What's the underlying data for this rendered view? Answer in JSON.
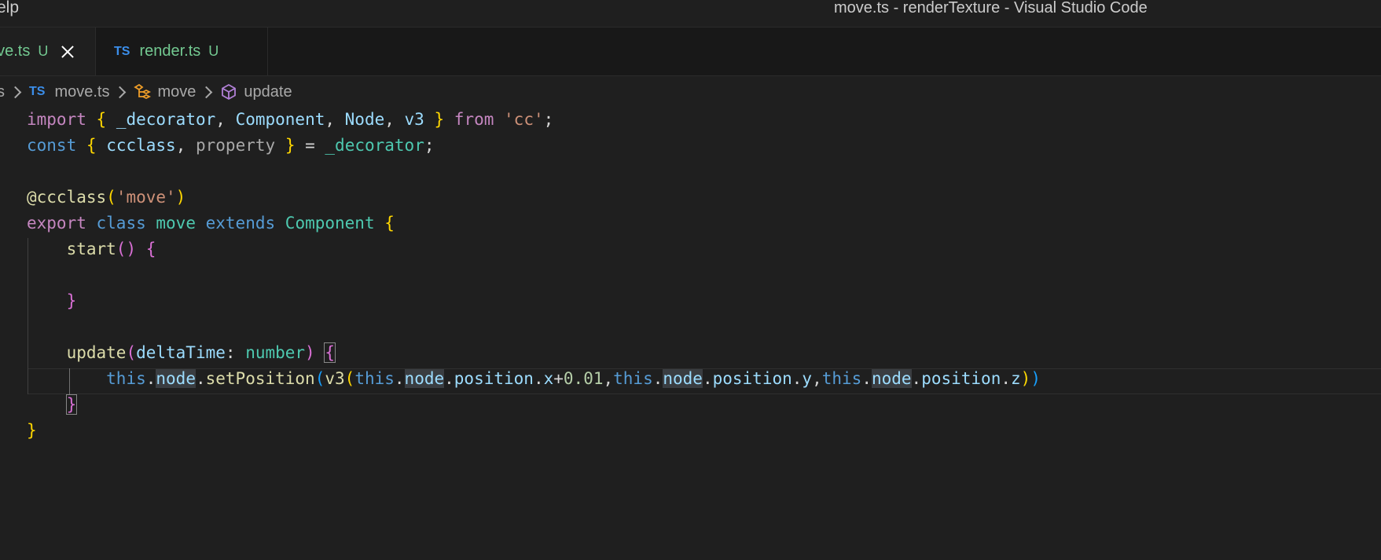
{
  "window": {
    "menu_partial": "elp",
    "title": "move.ts - renderTexture - Visual Studio Code"
  },
  "tabs": [
    {
      "icon": "ts-icon",
      "label": "ove.ts",
      "status": "U",
      "active": true,
      "close": "close-icon"
    },
    {
      "icon": "ts-icon",
      "label": "render.ts",
      "status": "U",
      "active": false
    }
  ],
  "breadcrumb": {
    "partial": "s",
    "file_icon": "TS",
    "file": "move.ts",
    "class": "move",
    "method": "update"
  },
  "code_lines": [
    [
      [
        "kw-ctrl",
        "import"
      ],
      [
        "punc",
        " "
      ],
      [
        "br1",
        "{"
      ],
      [
        "punc",
        " "
      ],
      [
        "var",
        "_decorator"
      ],
      [
        "punc",
        ", "
      ],
      [
        "var",
        "Component"
      ],
      [
        "punc",
        ", "
      ],
      [
        "var",
        "Node"
      ],
      [
        "punc",
        ", "
      ],
      [
        "var",
        "v3"
      ],
      [
        "punc",
        " "
      ],
      [
        "br1",
        "}"
      ],
      [
        "punc",
        " "
      ],
      [
        "kw-ctrl",
        "from"
      ],
      [
        "punc",
        " "
      ],
      [
        "str",
        "'cc'"
      ],
      [
        "punc",
        ";"
      ]
    ],
    [
      [
        "kw-store",
        "const"
      ],
      [
        "punc",
        " "
      ],
      [
        "br1",
        "{"
      ],
      [
        "punc",
        " "
      ],
      [
        "var",
        "ccclass"
      ],
      [
        "punc",
        ", "
      ],
      [
        "gray",
        "property"
      ],
      [
        "punc",
        " "
      ],
      [
        "br1",
        "}"
      ],
      [
        "punc",
        " = "
      ],
      [
        "cls",
        "_decorator"
      ],
      [
        "punc",
        ";"
      ]
    ],
    [],
    [
      [
        "fn",
        "@ccclass"
      ],
      [
        "br1",
        "("
      ],
      [
        "str",
        "'move'"
      ],
      [
        "br1",
        ")"
      ]
    ],
    [
      [
        "kw-ctrl",
        "export"
      ],
      [
        "punc",
        " "
      ],
      [
        "kw-store",
        "class"
      ],
      [
        "punc",
        " "
      ],
      [
        "cls",
        "move"
      ],
      [
        "punc",
        " "
      ],
      [
        "kw-store",
        "extends"
      ],
      [
        "punc",
        " "
      ],
      [
        "cls",
        "Component"
      ],
      [
        "punc",
        " "
      ],
      [
        "br1",
        "{"
      ]
    ],
    [
      [
        "punc",
        "    "
      ],
      [
        "fn",
        "start"
      ],
      [
        "br2",
        "()"
      ],
      [
        "punc",
        " "
      ],
      [
        "br2",
        "{"
      ]
    ],
    [],
    [
      [
        "punc",
        "    "
      ],
      [
        "br2",
        "}"
      ]
    ],
    [],
    [
      [
        "punc",
        "    "
      ],
      [
        "fn",
        "update"
      ],
      [
        "br2",
        "("
      ],
      [
        "var",
        "deltaTime"
      ],
      [
        "punc",
        ": "
      ],
      [
        "cls",
        "number"
      ],
      [
        "br2",
        ")"
      ],
      [
        "punc",
        " "
      ],
      [
        "br2",
        "{"
      ]
    ],
    [
      [
        "punc",
        "        "
      ],
      [
        "kw-store",
        "this"
      ],
      [
        "punc",
        "."
      ],
      [
        "var",
        "node"
      ],
      [
        "punc",
        "."
      ],
      [
        "fn",
        "setPosition"
      ],
      [
        "br3",
        "("
      ],
      [
        "fn",
        "v3"
      ],
      [
        "br1",
        "("
      ],
      [
        "kw-store",
        "this"
      ],
      [
        "punc",
        "."
      ],
      [
        "var",
        "node"
      ],
      [
        "punc",
        "."
      ],
      [
        "var",
        "position"
      ],
      [
        "punc",
        "."
      ],
      [
        "var",
        "x"
      ],
      [
        "punc",
        "+"
      ],
      [
        "num",
        "0.01"
      ],
      [
        "punc",
        ","
      ],
      [
        "kw-store",
        "this"
      ],
      [
        "punc",
        "."
      ],
      [
        "var",
        "node"
      ],
      [
        "punc",
        "."
      ],
      [
        "var",
        "position"
      ],
      [
        "punc",
        "."
      ],
      [
        "var",
        "y"
      ],
      [
        "punc",
        ","
      ],
      [
        "kw-store",
        "this"
      ],
      [
        "punc",
        "."
      ],
      [
        "var",
        "node"
      ],
      [
        "punc",
        "."
      ],
      [
        "var",
        "position"
      ],
      [
        "punc",
        "."
      ],
      [
        "var",
        "z"
      ],
      [
        "br1",
        ")"
      ],
      [
        "br3",
        ")"
      ]
    ],
    [
      [
        "punc",
        "    "
      ],
      [
        "br2",
        "}"
      ]
    ],
    [
      [
        "br1",
        "}"
      ]
    ]
  ]
}
